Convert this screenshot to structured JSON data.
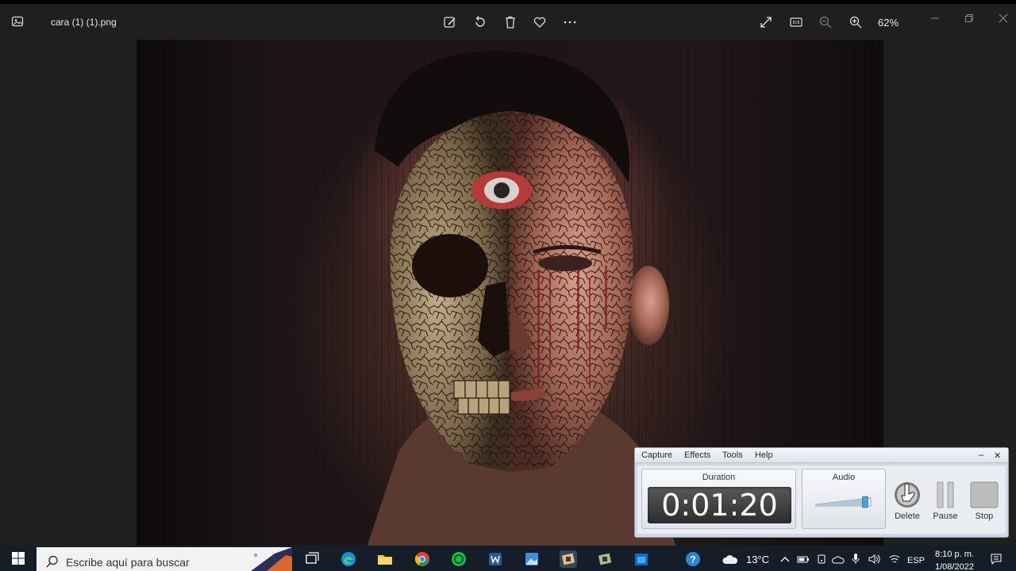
{
  "viewer": {
    "file_name": "cara (1) (1).png",
    "zoom": "62%"
  },
  "recorder": {
    "menu": [
      "Capture",
      "Effects",
      "Tools",
      "Help"
    ],
    "minimize": "–",
    "close": "✕",
    "duration_label": "Duration",
    "duration_value": "0:01:20",
    "audio_label": "Audio",
    "audio_level": 0.9,
    "delete_label": "Delete",
    "pause_label": "Pause",
    "stop_label": "Stop"
  },
  "taskbar": {
    "search_placeholder": "Escribe aquí para buscar",
    "temperature": "13°C",
    "language": "ESP",
    "time": "8:10 p. m.",
    "date": "1/08/2022"
  },
  "colors": {
    "app_bg": "#1f1f1f",
    "taskbar_bg": "#151d28",
    "recorder_bg": "#cfd8e4"
  }
}
